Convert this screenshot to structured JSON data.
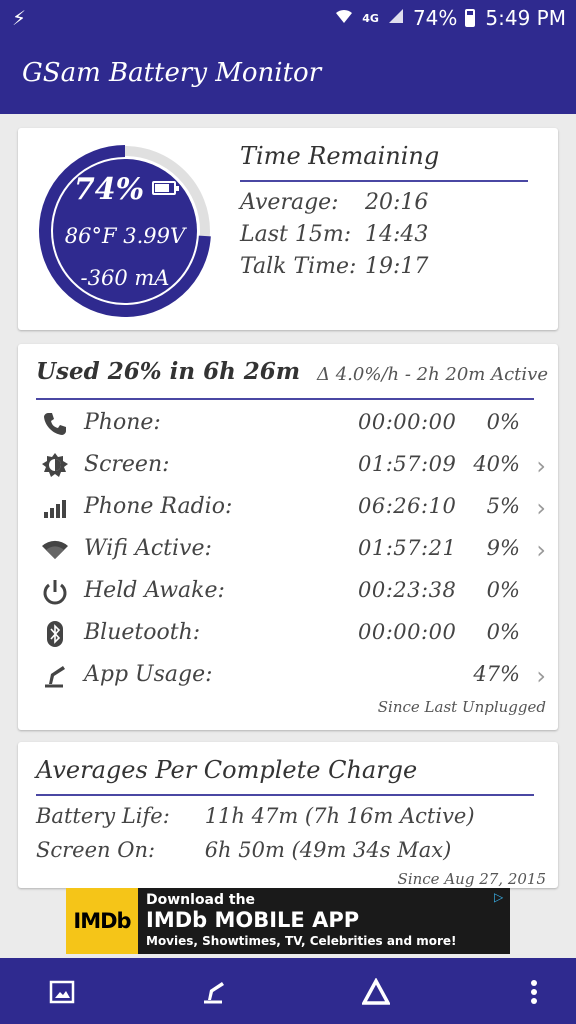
{
  "status_bar": {
    "left_icon": "flash-icon",
    "network": "4G",
    "battery_text": "74%",
    "time": "5:49 PM"
  },
  "app_bar": {
    "title": "GSam Battery Monitor"
  },
  "gauge": {
    "percent_text": "74%",
    "level": 0.74,
    "line2": "86°F 3.99V",
    "line3": "-360 mA",
    "fill_color": "#2f2a8f",
    "track_color": "#e0e0e0"
  },
  "time_remaining": {
    "title": "Time Remaining",
    "rows": [
      {
        "label": "Average:",
        "value": "20:16"
      },
      {
        "label": "Last 15m:",
        "value": "14:43"
      },
      {
        "label": "Talk Time:",
        "value": "19:17"
      }
    ]
  },
  "usage": {
    "title": "Used 26% in 6h 26m",
    "rate": "Δ 4.0%/h - 2h 20m Active",
    "rows": [
      {
        "icon": "phone-icon",
        "label": "Phone:",
        "time": "00:00:00",
        "pct": "0%",
        "chevron": false
      },
      {
        "icon": "screen-brightness-icon",
        "label": "Screen:",
        "time": "01:57:09",
        "pct": "40%",
        "chevron": true
      },
      {
        "icon": "signal-bars-icon",
        "label": "Phone Radio:",
        "time": "06:26:10",
        "pct": "5%",
        "chevron": true
      },
      {
        "icon": "wifi-icon",
        "label": "Wifi Active:",
        "time": "01:57:21",
        "pct": "9%",
        "chevron": true
      },
      {
        "icon": "power-icon",
        "label": "Held Awake:",
        "time": "00:23:38",
        "pct": "0%",
        "chevron": false
      },
      {
        "icon": "bluetooth-icon",
        "label": "Bluetooth:",
        "time": "00:00:00",
        "pct": "0%",
        "chevron": false
      },
      {
        "icon": "app-usage-icon",
        "label": "App Usage:",
        "time": "",
        "pct": "47%",
        "chevron": true
      }
    ],
    "since": "Since Last Unplugged"
  },
  "averages": {
    "title": "Averages Per Complete Charge",
    "rows": [
      {
        "label": "Battery Life:",
        "value": "11h 47m (7h 16m Active)"
      },
      {
        "label": "Screen On:",
        "value": "6h 50m (49m 34s Max)"
      }
    ],
    "since": "Since Aug 27, 2015"
  },
  "ad": {
    "logo": "IMDb",
    "line1": "Download the",
    "line2": "IMDb MOBILE APP",
    "line3": "Movies, Showtimes, TV, Celebrities and more!"
  },
  "bottom_bar": {
    "buttons": [
      "image-icon",
      "app-usage-icon",
      "delta-icon",
      "overflow-menu-icon"
    ]
  }
}
